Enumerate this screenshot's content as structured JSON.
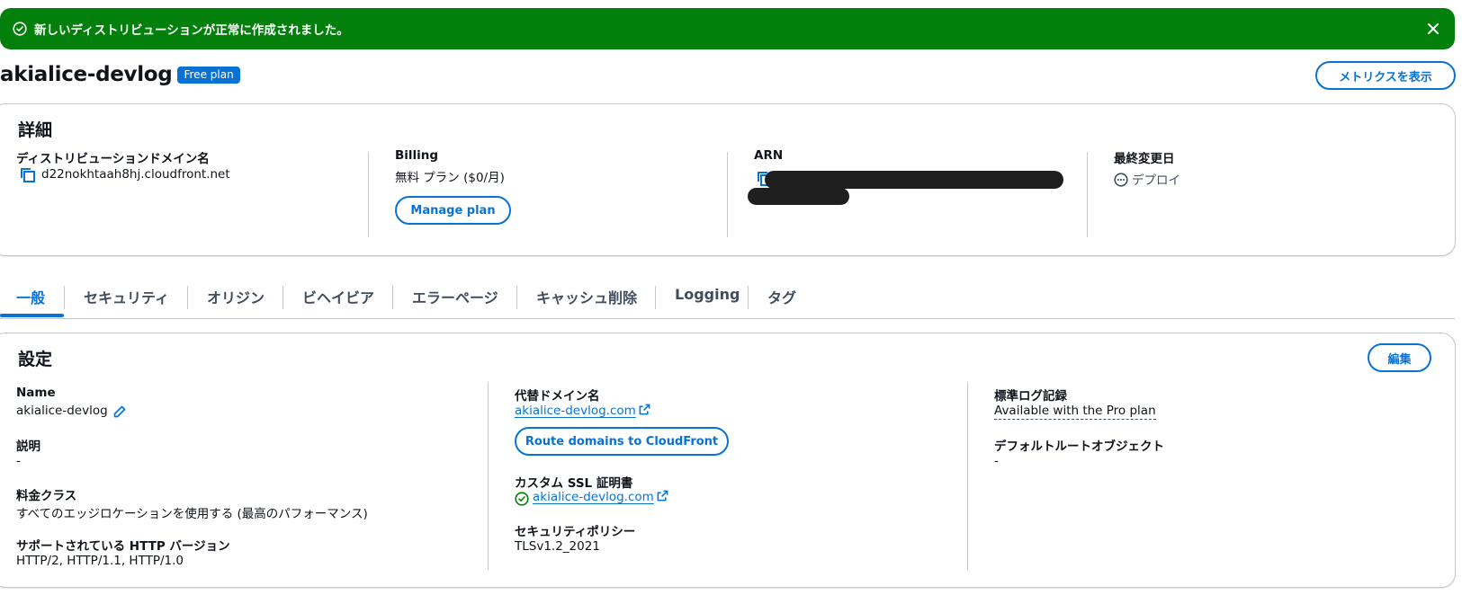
{
  "flash": {
    "message": "新しいディストリビューションが正常に作成されました。",
    "color": "#037f0c"
  },
  "header": {
    "title": "akialice-devlog",
    "badge": "Free plan",
    "metrics_button": "メトリクスを表示"
  },
  "details": {
    "title": "詳細",
    "domain_label": "ディストリビューションドメイン名",
    "domain_value": "d22nokhtaah8hj.cloudfront.net",
    "billing_label": "Billing",
    "billing_value": "無料 プラン ($0/月)",
    "manage_plan": "Manage plan",
    "arn_label": "ARN",
    "last_modified_label": "最終変更日",
    "last_modified_value": "デプロイ"
  },
  "tabs": [
    {
      "label": "一般",
      "active": true
    },
    {
      "label": "セキュリティ"
    },
    {
      "label": "オリジン"
    },
    {
      "label": "ビヘイビア"
    },
    {
      "label": "エラーページ"
    },
    {
      "label": "キャッシュ削除"
    },
    {
      "label": "Logging"
    },
    {
      "label": "タグ"
    }
  ],
  "settings": {
    "title": "設定",
    "edit_button": "編集",
    "name_label": "Name",
    "name_value": "akialice-devlog",
    "description_label": "説明",
    "description_value": "-",
    "price_class_label": "料金クラス",
    "price_class_value": "すべてのエッジロケーションを使用する (最高のパフォーマンス)",
    "http_label": "サポートされている HTTP バージョン",
    "http_value": "HTTP/2, HTTP/1.1, HTTP/1.0",
    "alt_domain_label": "代替ドメイン名",
    "alt_domain_value": "akialice-devlog.com",
    "route_button": "Route domains to CloudFront",
    "ssl_label": "カスタム SSL 証明書",
    "ssl_value": "akialice-devlog.com",
    "security_policy_label": "セキュリティポリシー",
    "security_policy_value": "TLSv1.2_2021",
    "std_log_label": "標準ログ記録",
    "std_log_value": "Available with the Pro plan",
    "default_root_label": "デフォルトルートオブジェクト",
    "default_root_value": "-"
  },
  "colors": {
    "accent": "#0972d3",
    "success": "#037f0c"
  }
}
